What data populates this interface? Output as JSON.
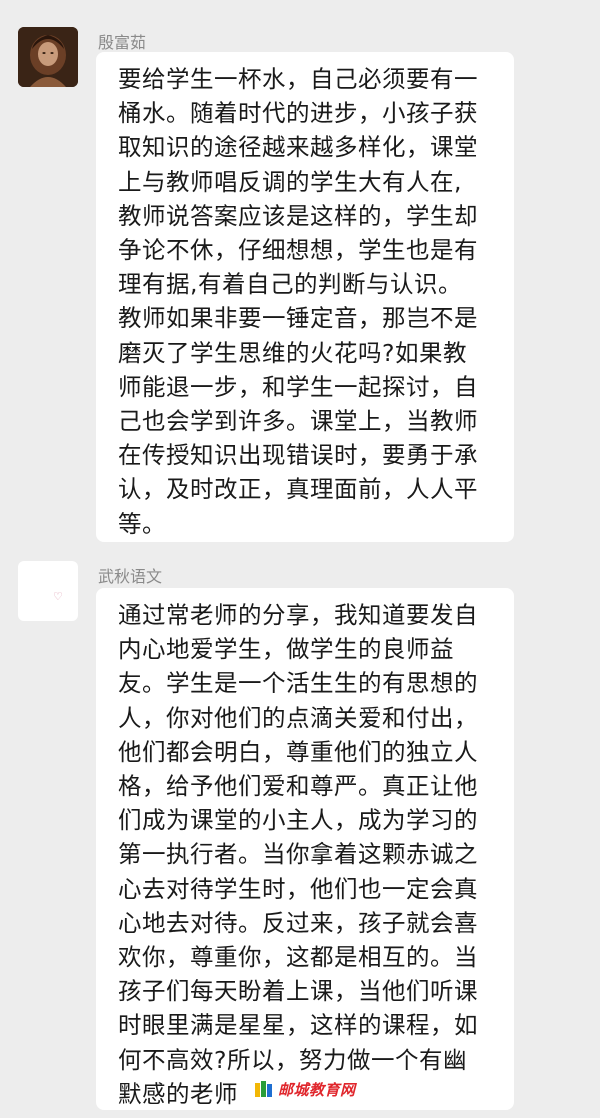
{
  "messages": [
    {
      "sender": "殷富茹",
      "avatar_icon": "portrait-painting-avatar",
      "text": "要给学生一杯水，自己必须要有一\n桶水。随着时代的进步，小孩子获\n取知识的途径越来越多样化，课堂\n上与教师唱反调的学生大有人在,\n教师说答案应该是这样的，学生却\n争论不休，仔细想想，学生也是有\n理有据,有着自己的判断与认识。\n教师如果非要一锤定音，那岂不是\n磨灭了学生思维的火花吗?如果教\n师能退一步，和学生一起探讨，自\n己也会学到许多。课堂上，当教师\n在传授知识出现错误时，要勇于承\n认，及时改正，真理面前，人人平\n等。"
    },
    {
      "sender": "武秋语文",
      "avatar_icon": "heart-avatar",
      "avatar_glyph": "♡",
      "text": "通过常老师的分享，我知道要发自\n内心地爱学生，做学生的良师益\n友。学生是一个活生生的有思想的\n人，你对他们的点滴关爱和付出，\n他们都会明白，尊重他们的独立人\n格，给予他们爱和尊严。真正让他\n们成为课堂的小主人，成为学习的\n第一执行者。当你拿着这颗赤诚之\n心去对待学生时，他们也一定会真\n心地去对待。反过来，孩子就会喜\n欢你，尊重你，这都是相互的。当\n孩子们每天盼着上课，当他们听课\n时眼里满是星星，这样的课程，如\n何不高效?所以，努力做一个有幽\n默感的老师"
    }
  ],
  "watermark": {
    "text": "邮城教育网",
    "icon": "book-logo-icon",
    "color": "#e0262c"
  },
  "colors": {
    "background": "#ededed",
    "bubble": "#ffffff",
    "sender_name": "#8a8a8a",
    "text": "#1a1a1a"
  }
}
